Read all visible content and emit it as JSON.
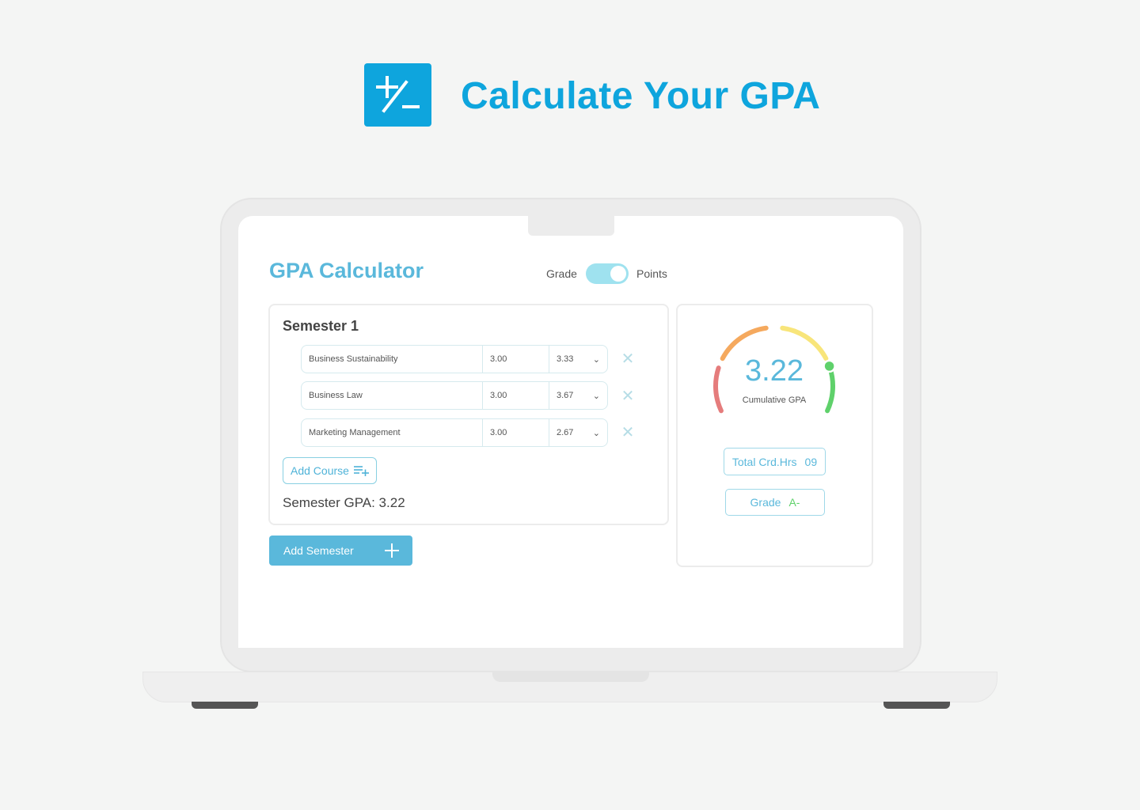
{
  "hero": {
    "title": "Calculate Your GPA",
    "icon": "plus-minus-icon"
  },
  "app": {
    "title": "GPA Calculator",
    "toggle": {
      "left": "Grade",
      "right": "Points",
      "state": "points"
    },
    "semester": {
      "title": "Semester 1",
      "courses": [
        {
          "name": "Business Sustainability",
          "credits": "3.00",
          "grade": "3.33"
        },
        {
          "name": "Business Law",
          "credits": "3.00",
          "grade": "3.67"
        },
        {
          "name": "Marketing Management",
          "credits": "3.00",
          "grade": "2.67"
        }
      ],
      "add_course": "Add Course",
      "gpa_text": "Semester GPA: 3.22"
    },
    "add_semester": "Add Semester",
    "summary": {
      "gpa": "3.22",
      "gpa_label": "Cumulative GPA",
      "gpa_value": 3.22,
      "gpa_max": 4.0,
      "credits_label": "Total Crd.Hrs",
      "credits": "09",
      "grade_label": "Grade",
      "grade": "A-"
    },
    "colors": {
      "accent": "#5ab8db",
      "brand": "#0ea5dd",
      "gauge": [
        "#e57c7c",
        "#f5a95e",
        "#f8e57a",
        "#5fd16b"
      ]
    }
  }
}
